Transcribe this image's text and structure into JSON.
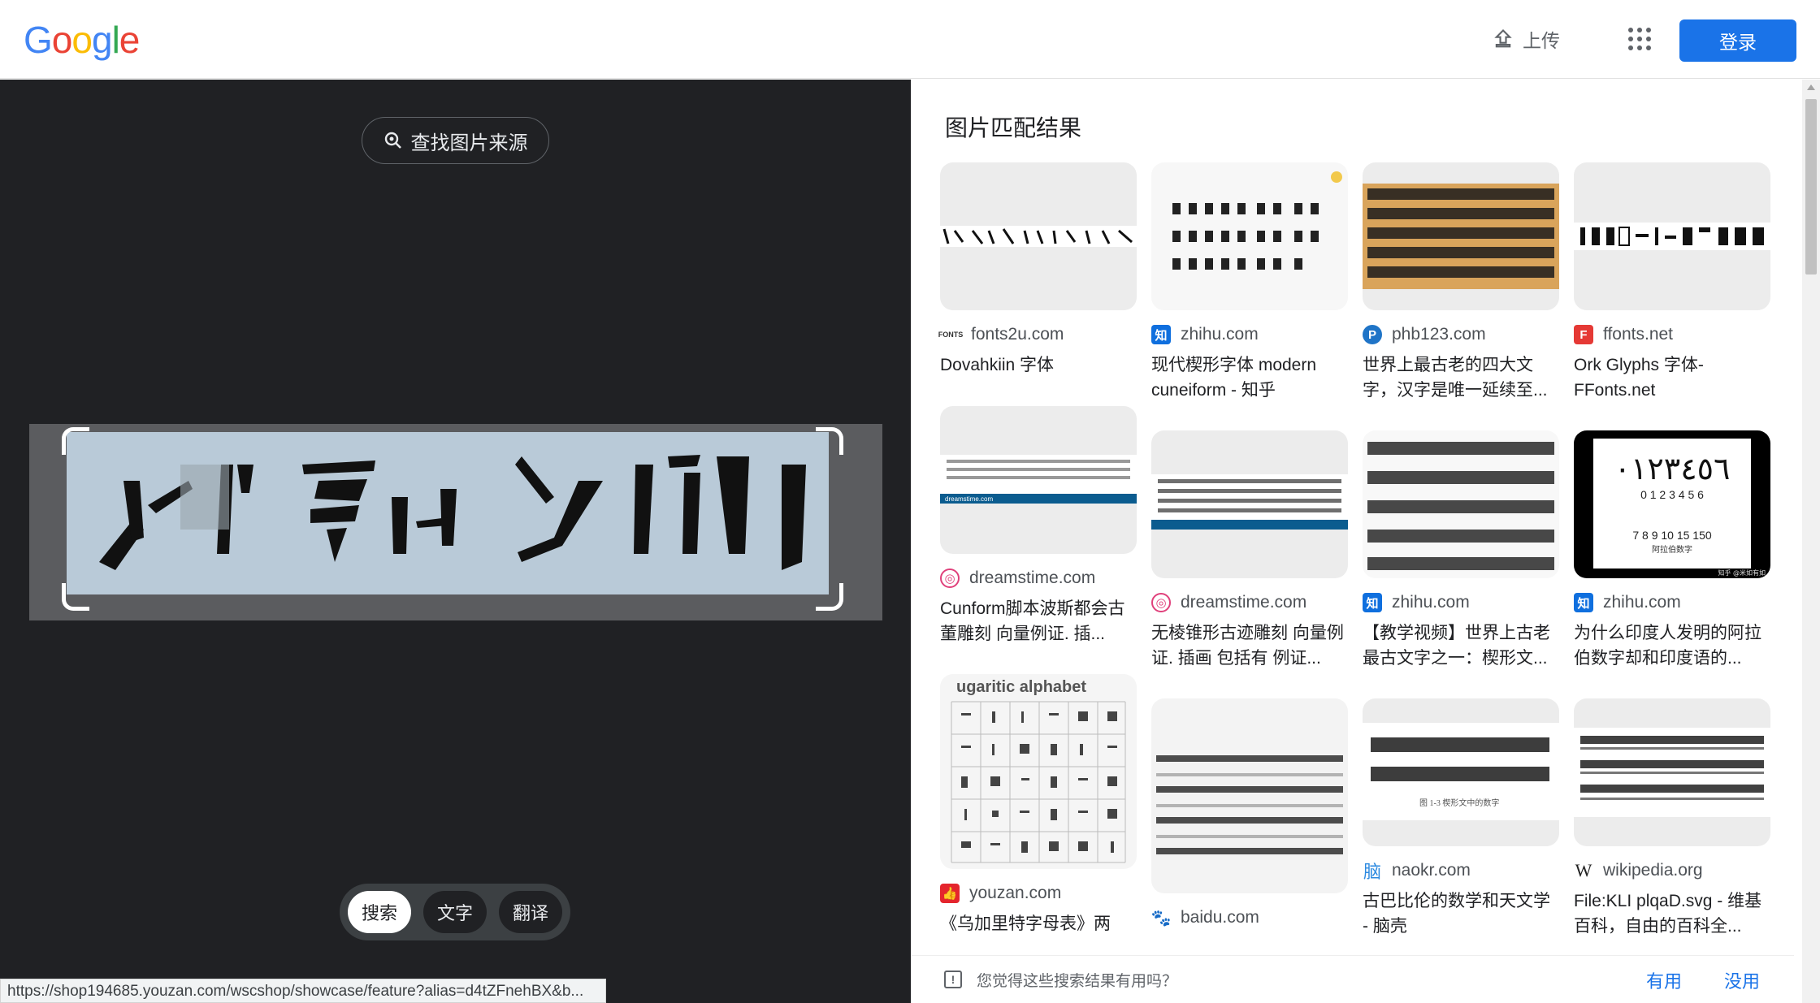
{
  "header": {
    "logo": "Google",
    "upload_label": "上传",
    "login_label": "登录"
  },
  "left": {
    "find_source_label": "查找图片来源",
    "modes": [
      "搜索",
      "文字",
      "翻译"
    ],
    "active_mode": "搜索",
    "status_url": "https://shop194685.youzan.com/wscshop/showcase/feature?alias=d4tZFnehBX&b..."
  },
  "results": {
    "title": "图片匹配结果",
    "cards": [
      {
        "site": "fonts2u.com",
        "title": "Dovahkiin 字体"
      },
      {
        "site": "zhihu.com",
        "title": "现代楔形字体 modern cuneiform - 知乎"
      },
      {
        "site": "phb123.com",
        "title": "世界上最古老的四大文字，汉字是唯一延续至..."
      },
      {
        "site": "ffonts.net",
        "title": "Ork Glyphs 字体- FFonts.net"
      },
      {
        "site": "dreamstime.com",
        "title": "Cunform脚本波斯都会古董雕刻 向量例证. 插..."
      },
      {
        "site": "dreamstime.com",
        "title": "无棱锥形古迹雕刻 向量例证. 插画 包括有 例证..."
      },
      {
        "site": "zhihu.com",
        "title": "【教学视频】世界上古老最古文字之一：楔形文..."
      },
      {
        "site": "zhihu.com",
        "title": "为什么印度人发明的阿拉伯数字却和印度语的..."
      },
      {
        "site": "youzan.com",
        "title": "《乌加里特字母表》两"
      },
      {
        "site": "baidu.com",
        "title": ""
      },
      {
        "site": "naokr.com",
        "title": "古巴比伦的数学和天文学 - 脑壳"
      },
      {
        "site": "wikipedia.org",
        "title": "File:KLI plqaD.svg - 维基百科，自由的百科全..."
      }
    ],
    "thumb_texts": {
      "ugaritic": "ugaritic alphabet",
      "arabic_digits": "٠١٢٣٤٥٦",
      "numbers_row1": "0 1 2 3 4 5 6",
      "numbers_row2": "7 8 9 10 15 150",
      "numbers_caption": "阿拉伯数字",
      "numbers_credit": "知乎 @米如有如",
      "dreamstime_mark": "dreamstime.com",
      "naokr_caption": "图 1-3 楔形文中的数字"
    }
  },
  "feedback": {
    "question": "您觉得这些搜索结果有用吗？",
    "yes": "有用",
    "no": "没用"
  },
  "colors": {
    "accent": "#1a73e8",
    "dark_bg": "#202124"
  }
}
